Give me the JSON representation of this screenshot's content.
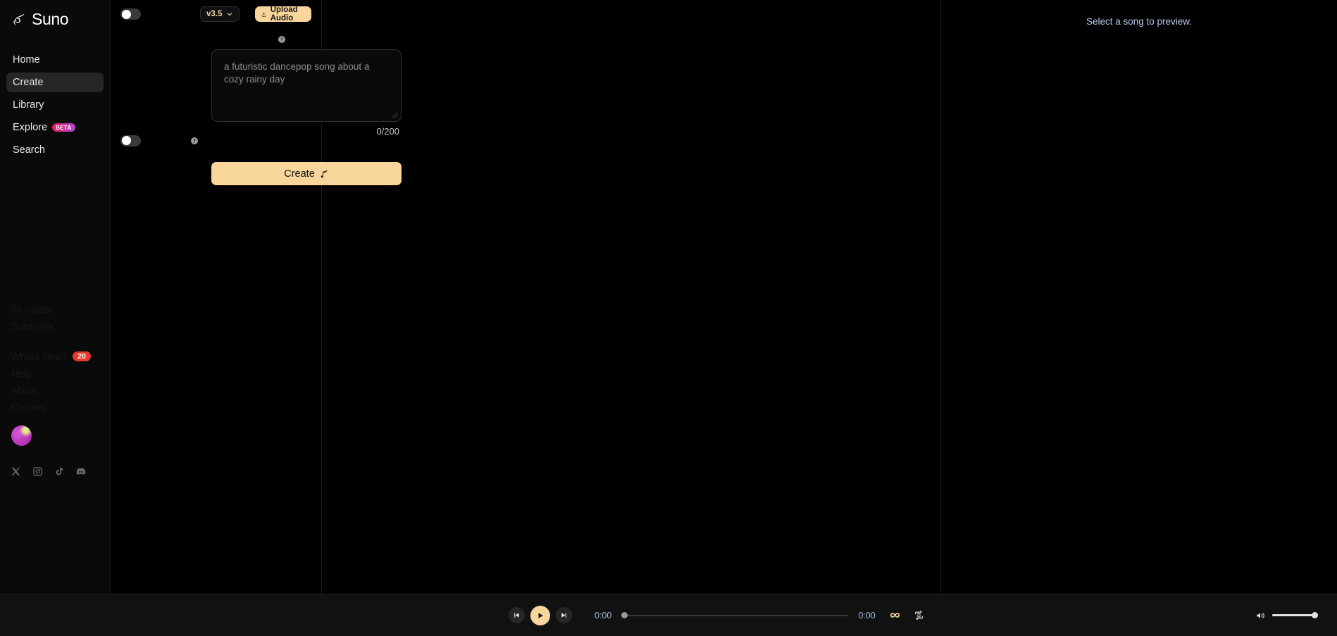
{
  "brand": {
    "name": "Suno",
    "logo_icon": "suno-logo-icon"
  },
  "sidebar": {
    "nav": [
      {
        "label": "Home",
        "active": false
      },
      {
        "label": "Create",
        "active": true
      },
      {
        "label": "Library",
        "active": false
      },
      {
        "label": "Explore",
        "active": false,
        "badge": "BETA"
      },
      {
        "label": "Search",
        "active": false
      }
    ],
    "footer": {
      "credits": "50 credits",
      "subscribe": "Subscribe",
      "whats_new": "What's New?",
      "whats_new_count": "20",
      "help": "Help",
      "about": "About",
      "careers": "Careers"
    },
    "socials": [
      {
        "name": "x-icon"
      },
      {
        "name": "instagram-icon"
      },
      {
        "name": "tiktok-icon"
      },
      {
        "name": "discord-icon"
      }
    ],
    "avatar_alt": "user-avatar"
  },
  "create": {
    "custom_mode_toggle": {
      "state": "off"
    },
    "instrumental_toggle": {
      "state": "off"
    },
    "version": {
      "label": "v3.5",
      "chevron_icon": "chevron-down-icon"
    },
    "upload_audio": {
      "label": "Upload Audio",
      "icon": "upload-icon"
    },
    "help_icon": "help-circle-icon",
    "prompt": {
      "placeholder": "a futuristic dancepop song about a cozy rainy day",
      "counter": "0/200"
    },
    "create_button": {
      "label": "Create",
      "icon": "music-note-sparkle-icon"
    }
  },
  "preview": {
    "message": "Select a song to preview."
  },
  "player": {
    "prev_icon": "skip-back-icon",
    "play_icon": "play-icon",
    "next_icon": "skip-forward-icon",
    "current_time": "0:00",
    "total_time": "0:00",
    "progress_percent": 0,
    "loop_icon": "infinity-icon",
    "repeat_icon": "repeat-icon",
    "volume_icon": "volume-icon",
    "volume_percent": 100
  },
  "colors": {
    "accent_cream": "#f8d59a",
    "badge_red": "#e8392f",
    "beta_pink": "#e8175d",
    "beta_purple": "#b24ad8",
    "preview_text": "#b9c7ef"
  }
}
